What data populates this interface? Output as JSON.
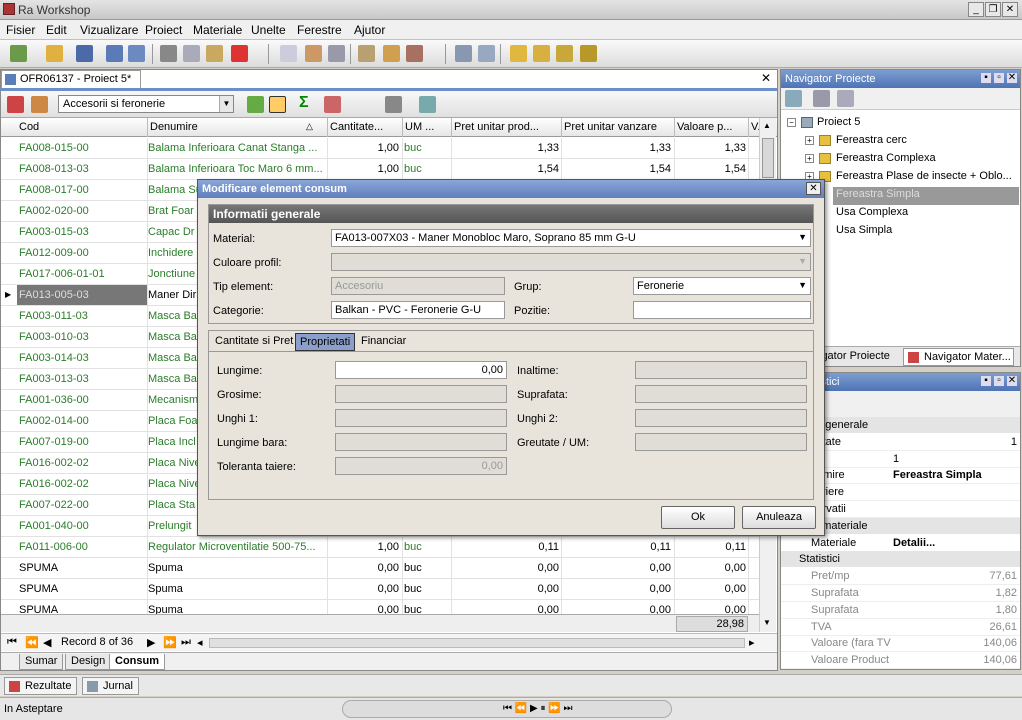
{
  "app": {
    "title": "Ra Workshop"
  },
  "menu": [
    "Fisier",
    "Edit",
    "Vizualizare",
    "Proiect",
    "Materiale",
    "Unelte",
    "Ferestre",
    "Ajutor"
  ],
  "doc": {
    "tab": "OFR06137 - Proiect 5*",
    "category": "Accesorii si feronerie"
  },
  "grid": {
    "columns": [
      "Cod",
      "Denumire",
      "Cantitate...",
      "UM ...",
      "Pret unitar prod...",
      "Pret unitar vanzare",
      "Valoare p...",
      "V..."
    ],
    "rows": [
      [
        "FA008-015-00",
        "Balama Inferioara Canat Stanga ...",
        "1,00",
        "buc",
        "1,33",
        "1,33",
        "1,33"
      ],
      [
        "FA008-013-03",
        "Balama Inferioara Toc Maro 6 mm...",
        "1,00",
        "buc",
        "1,54",
        "1,54",
        "1,54"
      ],
      [
        "FA008-017-00",
        "Balama Su",
        "",
        "",
        "",
        "",
        ""
      ],
      [
        "FA002-020-00",
        "Brat Foar",
        "",
        "",
        "",
        "",
        ""
      ],
      [
        "FA003-015-03",
        "Capac Dr",
        "",
        "",
        "",
        "",
        ""
      ],
      [
        "FA012-009-00",
        "Inchidere",
        "",
        "",
        "",
        "",
        ""
      ],
      [
        "FA017-006-01-01",
        "Jonctiune",
        "",
        "",
        "",
        "",
        ""
      ],
      [
        "FA013-005-03",
        "Maner Dir",
        "",
        "",
        "",
        "",
        ""
      ],
      [
        "FA003-011-03",
        "Masca Ba",
        "",
        "",
        "",
        "",
        ""
      ],
      [
        "FA003-010-03",
        "Masca Ba",
        "",
        "",
        "",
        "",
        ""
      ],
      [
        "FA003-014-03",
        "Masca Ba",
        "",
        "",
        "",
        "",
        ""
      ],
      [
        "FA003-013-03",
        "Masca Ba",
        "",
        "",
        "",
        "",
        ""
      ],
      [
        "FA001-036-00",
        "Mecanism",
        "",
        "",
        "",
        "",
        ""
      ],
      [
        "FA002-014-00",
        "Placa Foa",
        "",
        "",
        "",
        "",
        ""
      ],
      [
        "FA007-019-00",
        "Placa Incl",
        "",
        "",
        "",
        "",
        ""
      ],
      [
        "FA016-002-02",
        "Placa Nive",
        "",
        "",
        "",
        "",
        ""
      ],
      [
        "FA016-002-02",
        "Placa Nive",
        "",
        "",
        "",
        "",
        ""
      ],
      [
        "FA007-022-00",
        "Placa Sta",
        "",
        "",
        "",
        "",
        ""
      ],
      [
        "FA001-040-00",
        "Prelungit",
        "",
        "",
        "",
        "",
        ""
      ],
      [
        "FA011-006-00",
        "Regulator  Microventilatie 500-75...",
        "1,00",
        "buc",
        "0,11",
        "0,11",
        "0,11"
      ],
      [
        "SPUMA",
        "Spuma",
        "0,00",
        "buc",
        "0,00",
        "0,00",
        "0,00"
      ],
      [
        "SPUMA",
        "Spuma",
        "0,00",
        "buc",
        "0,00",
        "0,00",
        "0,00"
      ],
      [
        "SPUMA",
        "Spuma",
        "0,00",
        "buc",
        "0,00",
        "0,00",
        "0,00"
      ]
    ],
    "total": "28,98",
    "record": "Record 8 of 36"
  },
  "bottom_tabs": [
    "Sumar",
    "Design",
    "Consum"
  ],
  "output_tabs": [
    "Rezultate",
    "Jurnal"
  ],
  "status": "In Asteptare",
  "navigator": {
    "title": "Navigator Proiecte",
    "root": "Proiect 5",
    "items": [
      "Fereastra cerc",
      "Fereastra Complexa",
      "Fereastra Plase de insecte  + Oblo...",
      "Fereastra Simpla",
      "Usa Complexa",
      "Usa Simpla"
    ],
    "tabs": [
      "igator Proiecte",
      "Navigator Mater..."
    ]
  },
  "props": {
    "title": "tistici",
    "rows": [
      {
        "k": "matii generale",
        "v": "",
        "type": "cat"
      },
      {
        "k": "ntitate",
        "v": "1"
      },
      {
        "k": "d",
        "v": "1"
      },
      {
        "k": "numire",
        "v": "Fereastra Simpla",
        "bold": true
      },
      {
        "k": "scriere",
        "v": ""
      },
      {
        "k": "servatii",
        "v": ""
      },
      {
        "k": "natii materiale",
        "v": "",
        "type": "cat"
      },
      {
        "k": "Materiale",
        "v": "Detalii...",
        "bold": true
      },
      {
        "k": "Statistici",
        "v": "",
        "type": "cat"
      },
      {
        "k": "Pret/mp",
        "v": "77,61",
        "grey": true
      },
      {
        "k": "Suprafata",
        "v": "1,82",
        "grey": true
      },
      {
        "k": "Suprafata",
        "v": "1,80",
        "grey": true
      },
      {
        "k": "TVA",
        "v": "26,61",
        "grey": true
      },
      {
        "k": "Valoare (fara TV",
        "v": "140,06",
        "grey": true
      },
      {
        "k": "Valoare Product",
        "v": "140,06",
        "grey": true
      }
    ]
  },
  "dialog": {
    "title": "Modificare element consum",
    "group": "Informatii generale",
    "material_label": "Material:",
    "material_value": "FA013-007X03 - Maner Monobloc Maro, Soprano 85 mm G-U",
    "culoare_label": "Culoare profil:",
    "tip_label": "Tip element:",
    "tip_value": "Accesoriu",
    "grup_label": "Grup:",
    "grup_value": "Feronerie",
    "categorie_label": "Categorie:",
    "categorie_value": "Balkan - PVC - Feronerie G-U",
    "pozitie_label": "Pozitie:",
    "tabs": [
      "Cantitate si Pret",
      "Proprietati",
      "Financiar"
    ],
    "lungime_label": "Lungime:",
    "lungime_value": "0,00",
    "grosime_label": "Grosime:",
    "unghi1_label": "Unghi 1:",
    "lungimebara_label": "Lungime bara:",
    "toleranta_label": "Toleranta taiere:",
    "toleranta_value": "0,00",
    "inaltime_label": "Inaltime:",
    "suprafata_label": "Suprafata:",
    "unghi2_label": "Unghi 2:",
    "greutate_label": "Greutate / UM:",
    "ok": "Ok",
    "cancel": "Anuleaza"
  }
}
